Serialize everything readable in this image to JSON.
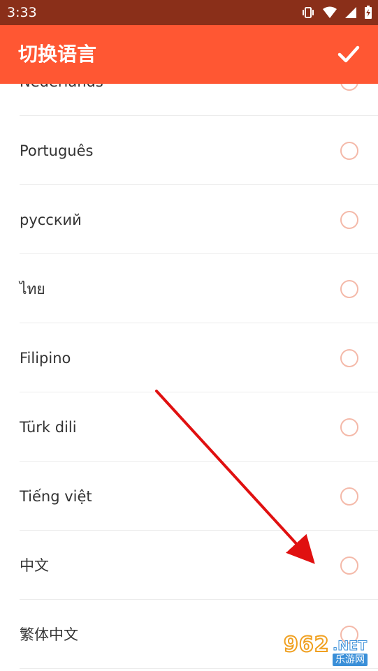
{
  "status_bar": {
    "time": "3:33",
    "icons": [
      "vibrate-icon",
      "wifi-icon",
      "signal-icon",
      "battery-icon"
    ]
  },
  "app_bar": {
    "title": "切换语言",
    "confirm_icon": "check-icon"
  },
  "languages": [
    {
      "label": "Nederlands",
      "selected": false
    },
    {
      "label": "Português",
      "selected": false
    },
    {
      "label": "русский",
      "selected": false
    },
    {
      "label": "ไทย",
      "selected": false
    },
    {
      "label": "Filipino",
      "selected": false
    },
    {
      "label": "Türk dili",
      "selected": false
    },
    {
      "label": "Tiếng việt",
      "selected": false
    },
    {
      "label": "中文",
      "selected": false
    },
    {
      "label": "繁体中文",
      "selected": false
    }
  ],
  "colors": {
    "status_bar": "#8a2f19",
    "app_bar": "#ff5733",
    "radio_outline": "#f4b9a9",
    "annotation_arrow": "#e01010"
  },
  "watermark": {
    "big": "962",
    "small": ".NET",
    "cn": "乐游网"
  }
}
